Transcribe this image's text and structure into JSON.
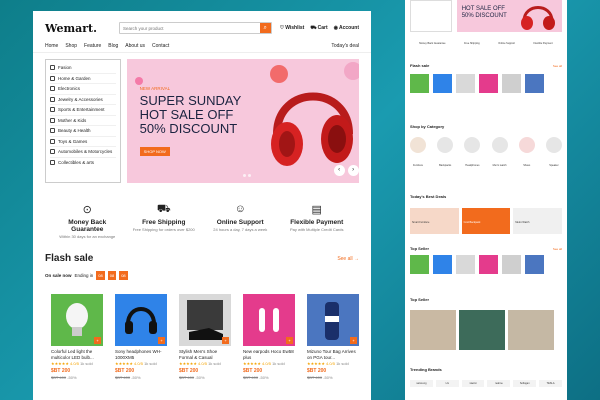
{
  "brand": "Wemart.",
  "search": {
    "placeholder": "Search your product"
  },
  "header_links": [
    "Wishlist",
    "Cart",
    "Account"
  ],
  "nav": {
    "items": [
      "Home",
      "Shop",
      "Feature",
      "Blog",
      "About us",
      "Contact"
    ],
    "right": "Today's deal"
  },
  "categories": [
    "Fasion",
    "Home & Garden",
    "Electronics",
    "Jewelry & Accessories",
    "Sports & Entertainment",
    "Mother & Kids",
    "Beauty & Health",
    "Toys & Games",
    "Automobiles & Motorcycles",
    "Collectibles & arts"
  ],
  "banner": {
    "tag": "NEW ARRIVAL",
    "line1": "SUPER SUNDAY",
    "line2": "HOT SALE OFF",
    "line3": "50% DISCOUNT",
    "button": "SHOP NOW",
    "bg_color": "#f7c8dc"
  },
  "features": [
    {
      "title": "Money Back Guarantee",
      "desc": "Within 30 days for an exchange",
      "icon": "money-back-icon"
    },
    {
      "title": "Free Shipping",
      "desc": "Free Shipping for orders over $200",
      "icon": "truck-icon"
    },
    {
      "title": "Online Support",
      "desc": "24 hours a day, 7 days a week",
      "icon": "support-icon"
    },
    {
      "title": "Flexible Payment",
      "desc": "Pay with Multiple Credit Cards",
      "icon": "card-icon"
    }
  ],
  "flash": {
    "title": "Flash sale",
    "see_all": "See all",
    "on_sale": "On sale now",
    "ending": "Ending in",
    "countdown": [
      "08",
      "08",
      "08"
    ]
  },
  "products": [
    {
      "name": "Colorful Led light the multicolor LED bulb...",
      "rating": "★★★★★ 4.0/5",
      "rating_suffix": "1k sold",
      "price": "$BT 200",
      "old": "$BT 400",
      "off": "-50%",
      "bg": "#5fb84a"
    },
    {
      "name": "Sony headphones WH-1000XM5",
      "rating": "★★★★★ 4.0/5",
      "rating_suffix": "1k sold",
      "price": "$BT 200",
      "old": "$BT 400",
      "off": "-50%",
      "bg": "#2f83e8"
    },
    {
      "name": "Stylish Men's Shoe Formal & Casual",
      "rating": "★★★★★ 4.0/5",
      "rating_suffix": "1k sold",
      "price": "$BT 200",
      "old": "$BT 400",
      "off": "-50%",
      "bg": "#d9d9d9"
    },
    {
      "name": "New earpods Hoco Ew58 plus",
      "rating": "★★★★★ 4.0/5",
      "rating_suffix": "1k sold",
      "price": "$BT 200",
      "old": "$BT 400",
      "off": "-50%",
      "bg": "#e43b8c"
    },
    {
      "name": "Mizuno Tour Bag Arrives on PGA tour...",
      "rating": "★★★★★ 4.0/5",
      "rating_suffix": "1k sold",
      "price": "$BT 200",
      "old": "$BT 400",
      "off": "-50%",
      "bg": "#4b76c0"
    }
  ],
  "side": {
    "banner": {
      "line1": "HOT SALE OFF",
      "line2": "50% DISCOUNT"
    },
    "feature_titles": [
      "Money Back Guarantee",
      "Free Shipping",
      "Online Support",
      "Flexible Payment"
    ],
    "flash_title": "Flash sale",
    "shop_by_category": "Shop by Category",
    "category_labels": [
      "Furniture",
      "Backpacks",
      "Headphones",
      "Men's watch",
      "Shoes",
      "Speaker"
    ],
    "best_deals": "Today's Best Deals",
    "best_items": [
      "Smart Furniture",
      "Cool Backpack",
      "Metro Watch"
    ],
    "top_seller": "Top Seller",
    "trending": "Trending Brands",
    "brands": [
      "samsung",
      "LG",
      "xiaomi",
      "realme",
      "Sollogan",
      "TESLA"
    ],
    "see_all": "See all"
  }
}
